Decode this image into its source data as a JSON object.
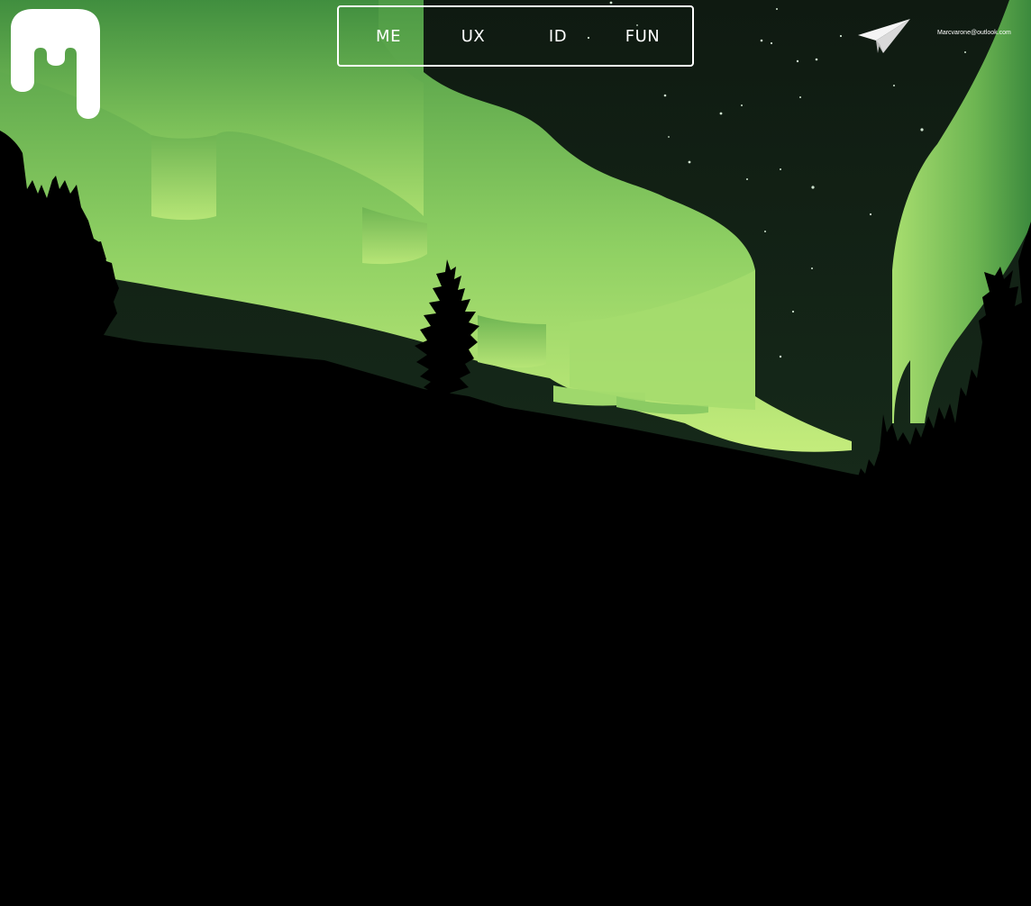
{
  "header": {
    "nav": [
      {
        "label": "ME"
      },
      {
        "label": "UX"
      },
      {
        "label": "ID"
      },
      {
        "label": "FUN"
      }
    ],
    "contact_icon": "paper-plane-icon",
    "email": "Marcvarone@outlook.com"
  },
  "logo": {
    "icon": "m-logo-icon"
  },
  "colors": {
    "sky": "#101a12",
    "aurora_light": "#b9e676",
    "aurora_mid": "#7cc45a",
    "aurora_deep": "#3e8a3c",
    "ground": "#000000",
    "text": "#ffffff"
  }
}
